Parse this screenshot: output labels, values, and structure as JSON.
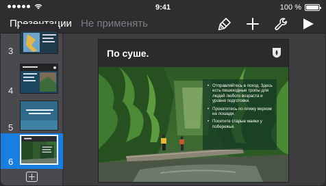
{
  "status_bar": {
    "time": "9:41",
    "battery_text": "100 %",
    "battery_level_percent": 100
  },
  "toolbar": {
    "presentations_label": "Презентации",
    "undo_label": "Не применять",
    "icons": [
      "paintbrush-icon",
      "plus-icon",
      "wrench-icon",
      "play-icon"
    ]
  },
  "sidebar": {
    "slides": [
      {
        "number": "3",
        "selected": false
      },
      {
        "number": "4",
        "selected": false
      },
      {
        "number": "5",
        "selected": false
      },
      {
        "number": "6",
        "selected": true
      }
    ]
  },
  "slide": {
    "title": "По суше.",
    "bullets": [
      "Отправляйтесь в поход. Здесь есть пешеходные тропы для людей любого возраста и уровня подготовки.",
      "Прокатитесь по пляжу верхом на лошади.",
      "Посетите старые маяки у побережья."
    ]
  },
  "colors": {
    "selection_blue": "#1a7ee0",
    "toolbar_bg": "#2e2e31",
    "sidebar_bg": "#4a4a4e"
  }
}
